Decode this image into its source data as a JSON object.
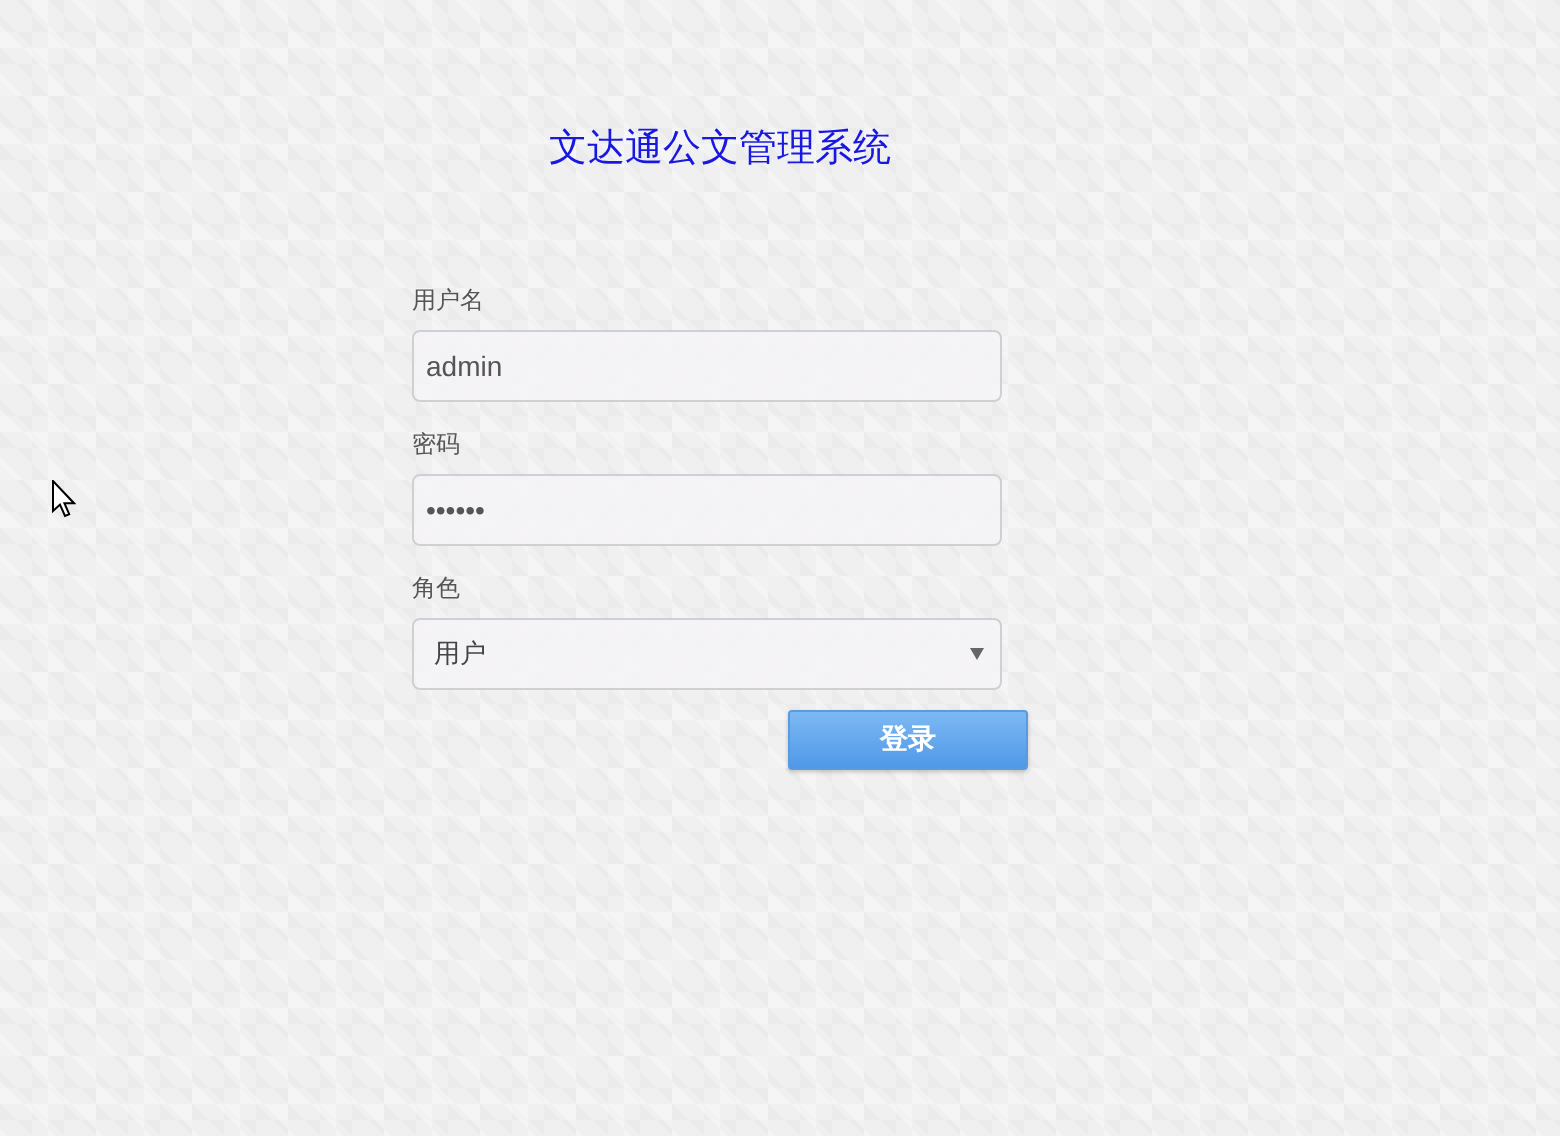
{
  "title": "文达通公文管理系统",
  "fields": [
    {
      "kind": "text",
      "label": "用户名",
      "value": "admin"
    },
    {
      "kind": "text",
      "label": "密码",
      "value": "••••••"
    },
    {
      "kind": "select",
      "label": "角色",
      "value": "用户"
    }
  ],
  "button": "登录"
}
